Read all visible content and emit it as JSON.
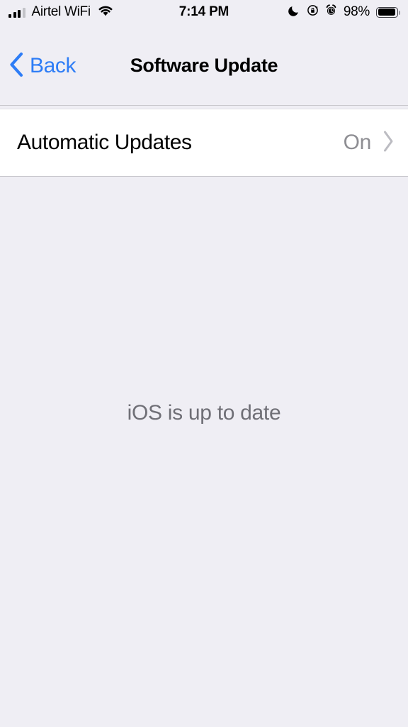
{
  "status_bar": {
    "carrier": "Airtel WiFi",
    "signal_bars_filled": 3,
    "signal_bars_total": 4,
    "wifi_icon": "wifi-icon",
    "time": "7:14 PM",
    "do_not_disturb_icon": "moon-icon",
    "rotation_lock_icon": "rotation-lock-icon",
    "alarm_icon": "alarm-clock-icon",
    "battery_percent": "98%",
    "battery_level": 98
  },
  "nav_bar": {
    "back_label": "Back",
    "back_icon": "chevron-left-icon",
    "title": "Software Update"
  },
  "main": {
    "rows": [
      {
        "label": "Automatic Updates",
        "value": "On",
        "disclosure_icon": "chevron-right-icon"
      }
    ],
    "status_message": "iOS is up to date"
  },
  "colors": {
    "accent": "#2e7df6",
    "background": "#efeef4",
    "row_background": "#ffffff",
    "secondary_text": "#8e8e93",
    "message_text": "#6f6f76"
  }
}
